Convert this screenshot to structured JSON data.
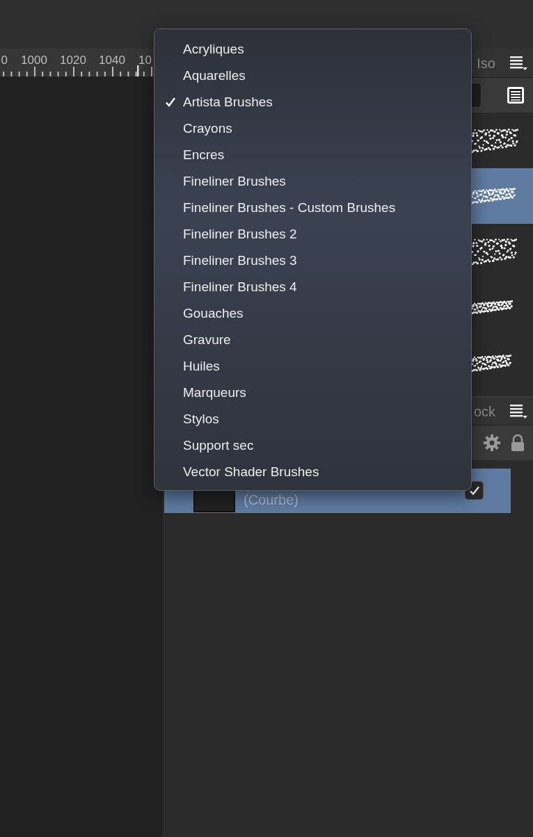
{
  "ruler": {
    "labels": [
      "0",
      "1000",
      "1020",
      "1040",
      "10"
    ]
  },
  "brushes_panel": {
    "tab": "Iso",
    "brushes": [
      {
        "selected": false
      },
      {
        "selected": true
      },
      {
        "selected": false
      },
      {
        "selected": false
      },
      {
        "selected": false
      }
    ]
  },
  "layers_panel": {
    "tab": "ock",
    "layers": [
      {
        "name": "(Courbe)",
        "selected": true,
        "visible": true
      }
    ]
  },
  "menu": {
    "items": [
      {
        "label": "Acryliques",
        "checked": false
      },
      {
        "label": "Aquarelles",
        "checked": false
      },
      {
        "label": "Artista Brushes",
        "checked": true
      },
      {
        "label": "Crayons",
        "checked": false
      },
      {
        "label": "Encres",
        "checked": false
      },
      {
        "label": "Fineliner Brushes",
        "checked": false
      },
      {
        "label": "Fineliner Brushes - Custom Brushes",
        "checked": false
      },
      {
        "label": "Fineliner Brushes 2",
        "checked": false
      },
      {
        "label": "Fineliner Brushes 3",
        "checked": false
      },
      {
        "label": "Fineliner Brushes 4",
        "checked": false
      },
      {
        "label": "Gouaches",
        "checked": false
      },
      {
        "label": "Gravure",
        "checked": false
      },
      {
        "label": "Huiles",
        "checked": false
      },
      {
        "label": "Marqueurs",
        "checked": false
      },
      {
        "label": "Stylos",
        "checked": false
      },
      {
        "label": "Support sec",
        "checked": false
      },
      {
        "label": "Vector Shader Brushes",
        "checked": false
      }
    ]
  }
}
